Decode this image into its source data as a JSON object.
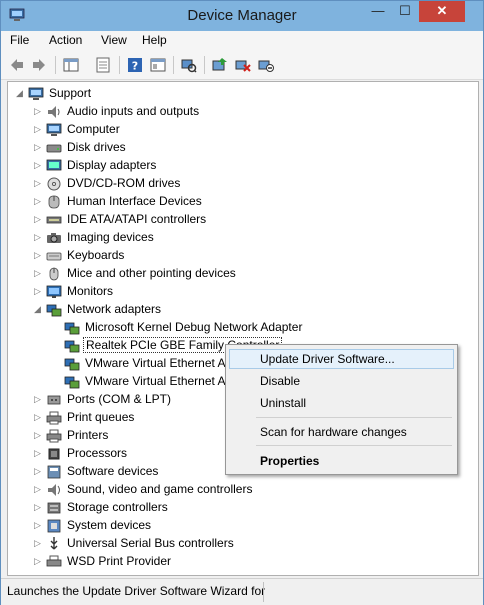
{
  "window": {
    "title": "Device Manager",
    "minimize": "—",
    "maximize": "☐",
    "close": "✕"
  },
  "menu": [
    "File",
    "Action",
    "View",
    "Help"
  ],
  "tree": {
    "root": "Support",
    "categories": [
      "Audio inputs and outputs",
      "Computer",
      "Disk drives",
      "Display adapters",
      "DVD/CD-ROM drives",
      "Human Interface Devices",
      "IDE ATA/ATAPI controllers",
      "Imaging devices",
      "Keyboards",
      "Mice and other pointing devices",
      "Monitors",
      "Network adapters"
    ],
    "network_children": [
      "Microsoft Kernel Debug Network Adapter",
      "Realtek PCIe GBE Family Controller",
      "VMware Virtual Ethernet A",
      "VMware Virtual Ethernet A"
    ],
    "categories_after": [
      "Ports (COM & LPT)",
      "Print queues",
      "Printers",
      "Processors",
      "Software devices",
      "Sound, video and game controllers",
      "Storage controllers",
      "System devices",
      "Universal Serial Bus controllers",
      "WSD Print Provider"
    ]
  },
  "context_menu": {
    "update": "Update Driver Software...",
    "disable": "Disable",
    "uninstall": "Uninstall",
    "scan": "Scan for hardware changes",
    "properties": "Properties"
  },
  "status": {
    "text": "Launches the Update Driver Software Wizard for"
  },
  "colors": {
    "titlebar": "#7fb3de",
    "close": "#c7443a",
    "hover": "#e5f1fb"
  }
}
